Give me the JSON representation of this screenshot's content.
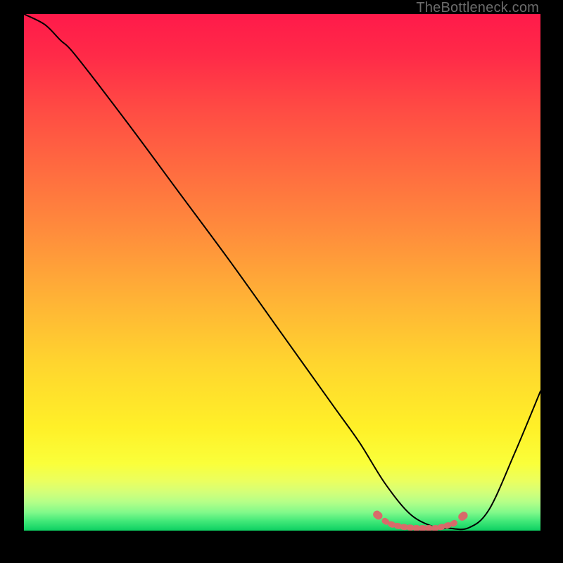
{
  "watermark": "TheBottleneck.com",
  "chart_data": {
    "type": "line",
    "title": "",
    "xlabel": "",
    "ylabel": "",
    "xlim": [
      0,
      100
    ],
    "ylim": [
      0,
      100
    ],
    "series": [
      {
        "name": "bottleneck-curve",
        "x": [
          0,
          4,
          7,
          10,
          20,
          30,
          40,
          50,
          60,
          65,
          70,
          75,
          80,
          82,
          86,
          90,
          95,
          100
        ],
        "values": [
          100,
          98,
          95,
          92,
          79,
          65.5,
          52,
          38,
          24,
          17,
          9,
          3,
          0.5,
          0.5,
          0.5,
          4,
          15,
          27
        ]
      }
    ],
    "markers": {
      "name": "optimal-region",
      "color": "#d86a6a",
      "points": [
        {
          "x": 68.5,
          "y": 3.0
        },
        {
          "x": 70.0,
          "y": 1.8
        },
        {
          "x": 71.2,
          "y": 1.2
        },
        {
          "x": 72.4,
          "y": 0.9
        },
        {
          "x": 73.6,
          "y": 0.7
        },
        {
          "x": 74.8,
          "y": 0.6
        },
        {
          "x": 76.0,
          "y": 0.5
        },
        {
          "x": 77.2,
          "y": 0.5
        },
        {
          "x": 78.4,
          "y": 0.5
        },
        {
          "x": 79.6,
          "y": 0.5
        },
        {
          "x": 80.8,
          "y": 0.7
        },
        {
          "x": 82.0,
          "y": 1.0
        },
        {
          "x": 83.2,
          "y": 1.4
        },
        {
          "x": 85.0,
          "y": 2.8
        }
      ]
    },
    "background_gradient": {
      "type": "vertical",
      "stops": [
        {
          "pos": 0.0,
          "color": "#ff1a4a"
        },
        {
          "pos": 0.08,
          "color": "#ff2a48"
        },
        {
          "pos": 0.18,
          "color": "#ff4a44"
        },
        {
          "pos": 0.3,
          "color": "#ff6b40"
        },
        {
          "pos": 0.42,
          "color": "#ff8c3c"
        },
        {
          "pos": 0.55,
          "color": "#ffb236"
        },
        {
          "pos": 0.68,
          "color": "#ffd62e"
        },
        {
          "pos": 0.8,
          "color": "#fff028"
        },
        {
          "pos": 0.87,
          "color": "#faff3a"
        },
        {
          "pos": 0.905,
          "color": "#eaff60"
        },
        {
          "pos": 0.925,
          "color": "#d4ff78"
        },
        {
          "pos": 0.945,
          "color": "#b4ff88"
        },
        {
          "pos": 0.965,
          "color": "#80f98a"
        },
        {
          "pos": 0.982,
          "color": "#40e878"
        },
        {
          "pos": 1.0,
          "color": "#0dd062"
        }
      ]
    }
  }
}
